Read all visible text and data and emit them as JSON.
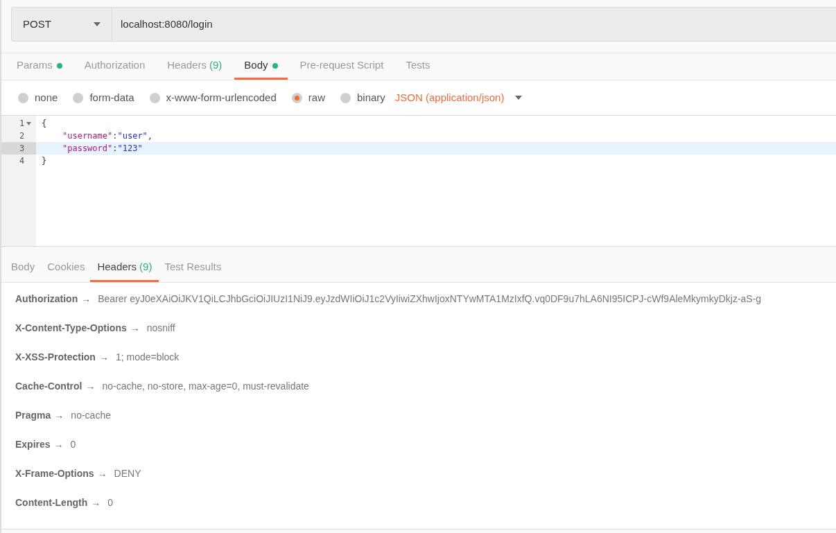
{
  "request": {
    "method": "POST",
    "url": "localhost:8080/login"
  },
  "request_tabs": [
    {
      "label": "Params",
      "dot": true,
      "selected": false
    },
    {
      "label": "Authorization",
      "dot": false,
      "selected": false
    },
    {
      "label": "Headers",
      "count": "(9)",
      "dot": false,
      "selected": false
    },
    {
      "label": "Body",
      "dot": true,
      "selected": true
    },
    {
      "label": "Pre-request Script",
      "dot": false,
      "selected": false
    },
    {
      "label": "Tests",
      "dot": false,
      "selected": false
    }
  ],
  "body_modes": [
    {
      "label": "none",
      "selected": false
    },
    {
      "label": "form-data",
      "selected": false
    },
    {
      "label": "x-www-form-urlencoded",
      "selected": false
    },
    {
      "label": "raw",
      "selected": true
    },
    {
      "label": "binary",
      "selected": false
    }
  ],
  "content_type": "JSON (application/json)",
  "editor_lines": [
    {
      "number": "1",
      "foldable": true,
      "indented": false,
      "active": false,
      "tokens": [
        {
          "kind": "punct",
          "text": "{"
        }
      ]
    },
    {
      "number": "2",
      "foldable": false,
      "indented": true,
      "active": false,
      "tokens": [
        {
          "kind": "key",
          "text": "\"username\""
        },
        {
          "kind": "punct",
          "text": ":"
        },
        {
          "kind": "string",
          "text": "\"user\""
        },
        {
          "kind": "punct",
          "text": ","
        }
      ]
    },
    {
      "number": "3",
      "foldable": false,
      "indented": true,
      "active": true,
      "tokens": [
        {
          "kind": "key",
          "text": "\"password\""
        },
        {
          "kind": "punct",
          "text": ":"
        },
        {
          "kind": "string",
          "text": "\"123\""
        }
      ]
    },
    {
      "number": "4",
      "foldable": false,
      "indented": false,
      "active": false,
      "tokens": [
        {
          "kind": "punct",
          "text": "}"
        }
      ]
    }
  ],
  "response_tabs": [
    {
      "label": "Body",
      "selected": false
    },
    {
      "label": "Cookies",
      "selected": false
    },
    {
      "label": "Headers",
      "count": "(9)",
      "selected": true
    },
    {
      "label": "Test Results",
      "selected": false
    }
  ],
  "response_headers": [
    {
      "name": "Authorization",
      "arrow": "→",
      "value": "Bearer eyJ0eXAiOiJKV1QiLCJhbGciOiJIUzI1NiJ9.eyJzdWIiOiJ1c2VyIiwiZXhwIjoxNTYwMTA1MzIxfQ.vq0DF9u7hLA6NI95ICPJ-cWf9AleMkymkyDkjz-aS-g"
    },
    {
      "name": "X-Content-Type-Options",
      "arrow": "→",
      "value": "nosniff"
    },
    {
      "name": "X-XSS-Protection",
      "arrow": "→",
      "value": "1; mode=block"
    },
    {
      "name": "Cache-Control",
      "arrow": "→",
      "value": "no-cache, no-store, max-age=0, must-revalidate"
    },
    {
      "name": "Pragma",
      "arrow": "→",
      "value": "no-cache"
    },
    {
      "name": "Expires",
      "arrow": "→",
      "value": "0"
    },
    {
      "name": "X-Frame-Options",
      "arrow": "→",
      "value": "DENY"
    },
    {
      "name": "Content-Length",
      "arrow": "→",
      "value": "0"
    }
  ]
}
